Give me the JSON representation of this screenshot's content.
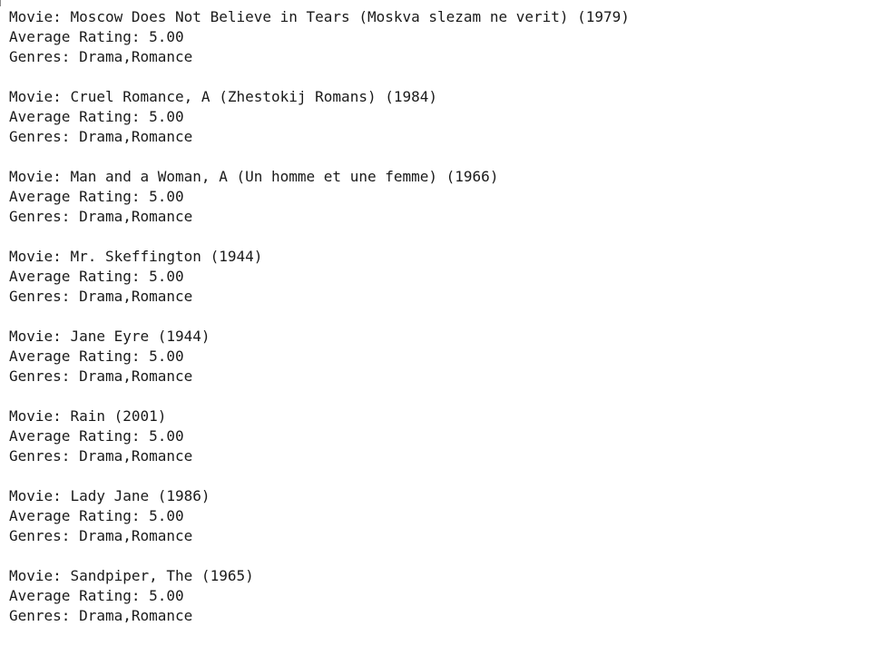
{
  "labels": {
    "movie": "Movie: ",
    "rating": "Average Rating: ",
    "genres": "Genres: "
  },
  "records": [
    {
      "title": "Moscow Does Not Believe in Tears (Moskva slezam ne verit) (1979)",
      "rating": "5.00",
      "genres": "Drama,Romance"
    },
    {
      "title": "Cruel Romance, A (Zhestokij Romans) (1984)",
      "rating": "5.00",
      "genres": "Drama,Romance"
    },
    {
      "title": "Man and a Woman, A (Un homme et une femme) (1966)",
      "rating": "5.00",
      "genres": "Drama,Romance"
    },
    {
      "title": "Mr. Skeffington (1944)",
      "rating": "5.00",
      "genres": "Drama,Romance"
    },
    {
      "title": "Jane Eyre (1944)",
      "rating": "5.00",
      "genres": "Drama,Romance"
    },
    {
      "title": "Rain (2001)",
      "rating": "5.00",
      "genres": "Drama,Romance"
    },
    {
      "title": "Lady Jane (1986)",
      "rating": "5.00",
      "genres": "Drama,Romance"
    },
    {
      "title": "Sandpiper, The (1965)",
      "rating": "5.00",
      "genres": "Drama,Romance"
    }
  ]
}
